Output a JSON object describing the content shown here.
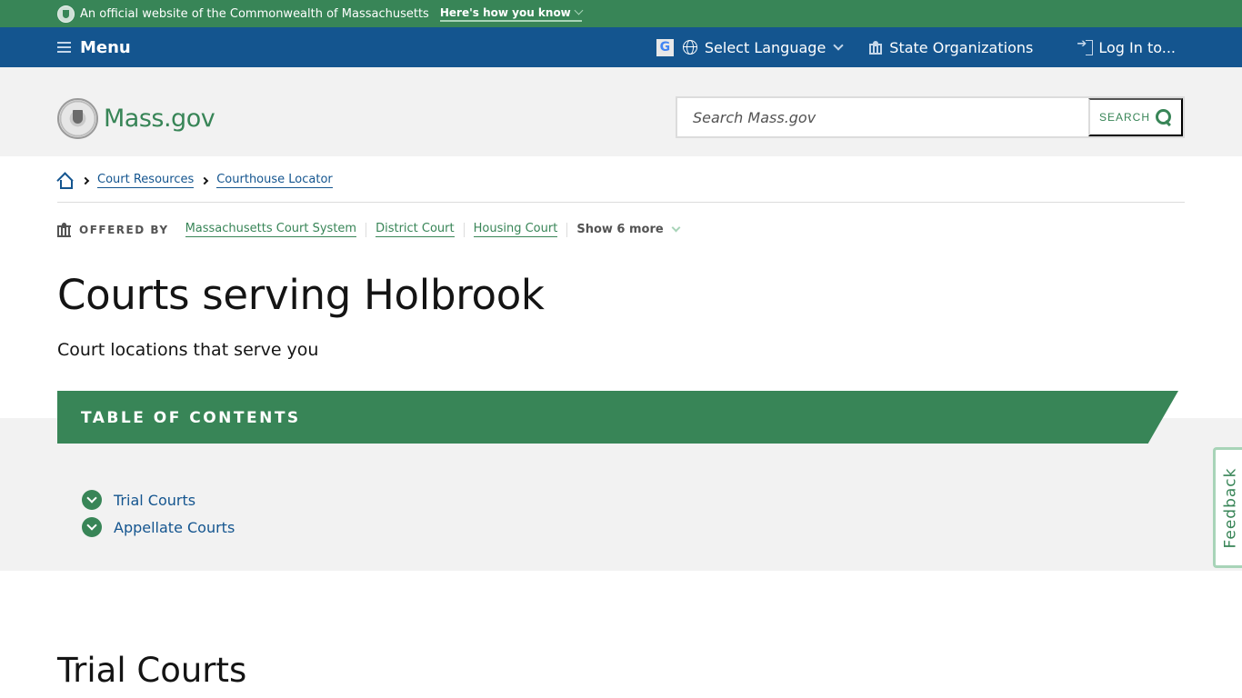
{
  "official_banner": {
    "text": "An official website of the Commonwealth of Massachusetts",
    "how_link": "Here's how you know"
  },
  "utility_nav": {
    "menu_label": "Menu",
    "google_letter": "G",
    "language_label": "Select Language",
    "state_orgs_label": "State Organizations",
    "login_label": "Log In to..."
  },
  "header": {
    "logo_text": "Mass.gov",
    "search_placeholder": "Search Mass.gov",
    "search_value": "",
    "search_button": "SEARCH"
  },
  "breadcrumbs": [
    {
      "label": "Court Resources"
    },
    {
      "label": "Courthouse Locator"
    }
  ],
  "offered_by": {
    "label": "OFFERED BY",
    "orgs": [
      "Massachusetts Court System",
      "District Court",
      "Housing Court"
    ],
    "show_more": "Show 6 more"
  },
  "page": {
    "title": "Courts serving Holbrook",
    "subtitle": "Court locations that serve you"
  },
  "toc": {
    "title": "TABLE OF CONTENTS",
    "items": [
      {
        "label": "Trial Courts"
      },
      {
        "label": "Appellate Courts"
      }
    ]
  },
  "feedback_label": "Feedback",
  "sections": [
    {
      "heading": "Trial Courts"
    }
  ],
  "colors": {
    "brand_green": "#388557",
    "nav_blue": "#14558f",
    "header_gray": "#f2f2f2"
  }
}
